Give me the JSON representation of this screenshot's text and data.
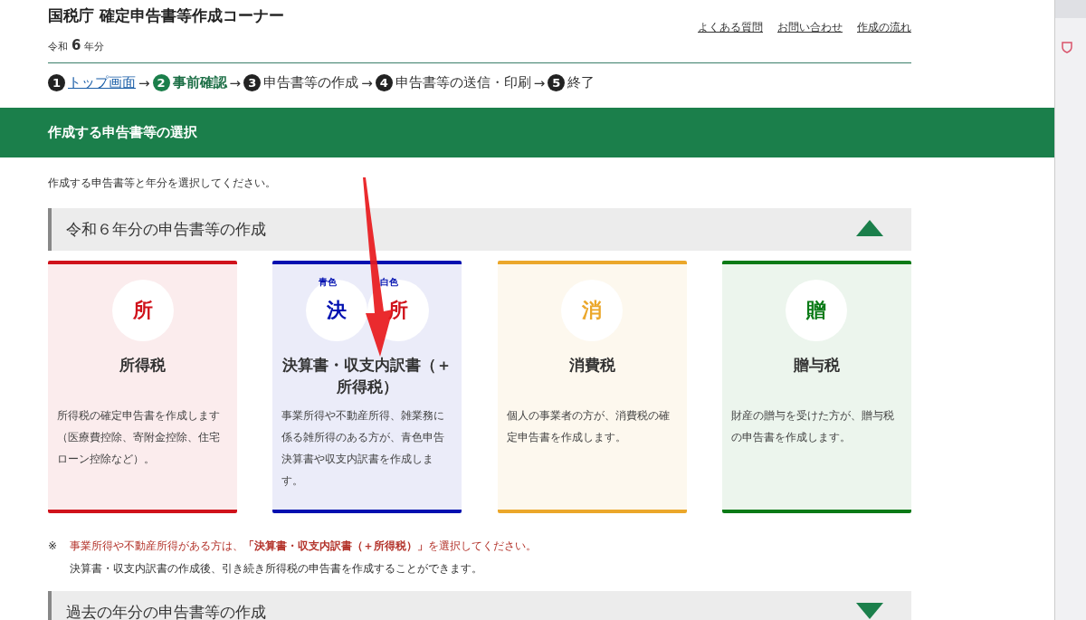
{
  "header": {
    "title": "国税庁 確定申告書等作成コーナー",
    "year_prefix": "令和",
    "year": "6",
    "year_suffix": "年分",
    "links": [
      "よくある質問",
      "お問い合わせ",
      "作成の流れ"
    ]
  },
  "steps": [
    {
      "number": "1",
      "label": "トップ画面",
      "kind": "link",
      "selected": false
    },
    {
      "number": "2",
      "label": "事前確認",
      "kind": "plain",
      "selected": true
    },
    {
      "number": "3",
      "label": "申告書等の作成",
      "kind": "plain",
      "selected": false
    },
    {
      "number": "4",
      "label": "申告書等の送信・印刷",
      "kind": "plain",
      "selected": false
    },
    {
      "number": "5",
      "label": "終了",
      "kind": "plain",
      "selected": false
    }
  ],
  "step_separator": "→",
  "page_title": "作成する申告書等の選択",
  "instruction": "作成する申告書等と年分を選択してください。",
  "sections": [
    {
      "title": "令和６年分の申告書等の作成",
      "expanded": true
    },
    {
      "title": "過去の年分の申告書等の作成",
      "expanded": false
    }
  ],
  "cards": [
    {
      "color": "#d0121b",
      "title": "所得税",
      "description": "所得税の確定申告書を作成します（医療費控除、寄附金控除、住宅ローン控除など）。",
      "icons": [
        {
          "char": "所",
          "color": "#d0121b"
        }
      ]
    },
    {
      "color": "#0010b0",
      "title": "決算書・収支内訳書（＋所得税）",
      "description": "事業所得や不動産所得、雑業務に係る雑所得のある方が、青色申告決算書や収支内訳書を作成します。",
      "icons": [
        {
          "tag": "青色",
          "char": "決",
          "color": "#0010b0"
        },
        {
          "tag": "白色",
          "char": "所",
          "color": "#d0121b"
        }
      ]
    },
    {
      "color": "#eba72a",
      "title": "消費税",
      "description": "個人の事業者の方が、消費税の確定申告書を作成します。",
      "icons": [
        {
          "char": "消",
          "color": "#eba72a"
        }
      ]
    },
    {
      "color": "#0a7a16",
      "title": "贈与税",
      "description": "財産の贈与を受けた方が、贈与税の申告書を作成します。",
      "icons": [
        {
          "char": "贈",
          "color": "#0a7a16"
        }
      ]
    }
  ],
  "note": {
    "mark": "※",
    "warning": "事業所得や不動産所得がある方は、**「決算書・収支内訳書（＋所得税）」**を選択してください。",
    "detail": "決算書・収支内訳書の作成後、引き続き所得税の申告書を作成することができます。"
  }
}
